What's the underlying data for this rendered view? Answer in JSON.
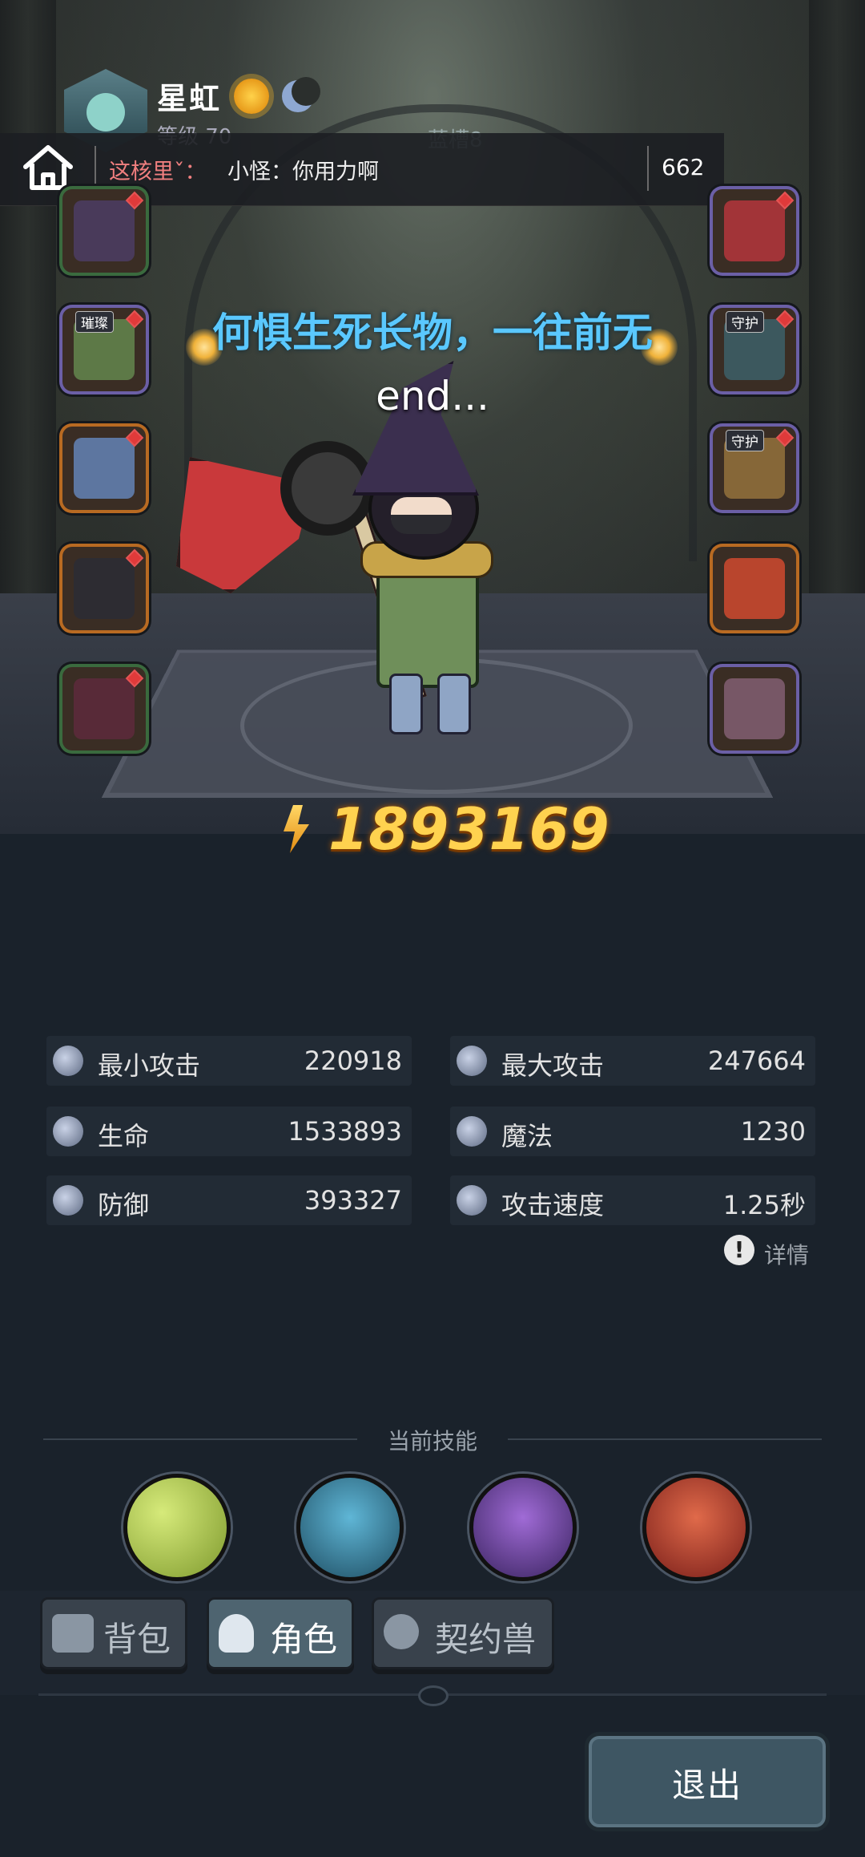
{
  "player": {
    "name": "星虹",
    "level_text": "等级 70",
    "mana_text": "蓝槽8"
  },
  "chat": {
    "sender": "这核里ˇ：",
    "message": "小怪：你用力啊",
    "count": "662"
  },
  "motto": "何惧生死长物，一往前无",
  "motto_sub": "end...",
  "power": "1893169",
  "equipment": {
    "left": [
      {
        "icon": "helmet-icon",
        "color": "#3a6a3e"
      },
      {
        "icon": "armor-icon",
        "tag": "璀璨",
        "color": "#6b5fa6"
      },
      {
        "icon": "boots-icon",
        "color": "#b86a22"
      },
      {
        "icon": "gloves-icon",
        "color": "#b86a22"
      },
      {
        "icon": "cloak-icon",
        "color": "#3a6a3e"
      }
    ],
    "right": [
      {
        "icon": "axe-weapon-icon",
        "color": "#6b5fa6"
      },
      {
        "icon": "ring-icon",
        "tag": "守护",
        "color": "#6b5fa6"
      },
      {
        "icon": "necklace-icon",
        "tag": "守护",
        "color": "#6b5fa6"
      },
      {
        "icon": "charm-icon",
        "color": "#b86a22"
      },
      {
        "icon": "pouch-icon",
        "color": "#6b5fa6"
      }
    ]
  },
  "stats": [
    {
      "label": "最小攻击",
      "value": "220918",
      "icon": "sword-icon"
    },
    {
      "label": "最大攻击",
      "value": "247664",
      "icon": "sword-icon"
    },
    {
      "label": "生命",
      "value": "1533893",
      "icon": "heart-icon"
    },
    {
      "label": "魔法",
      "value": "1230",
      "icon": "magic-icon"
    },
    {
      "label": "防御",
      "value": "393327",
      "icon": "shield-icon"
    },
    {
      "label": "攻击速度",
      "value": "1.25秒",
      "icon": "speed-icon"
    }
  ],
  "detail_label": "详情",
  "skills_title": "当前技能",
  "skills": [
    {
      "icon": "poison-bubbles-skill-icon",
      "color": "#9fb84a"
    },
    {
      "icon": "water-shield-skill-icon",
      "color": "#2f6e86"
    },
    {
      "icon": "purple-blade-skill-icon",
      "color": "#5b3f86"
    },
    {
      "icon": "crossed-axes-skill-icon",
      "color": "#b33b2b"
    }
  ],
  "tabs": [
    {
      "label": "背包",
      "icon": "bag-icon"
    },
    {
      "label": "角色",
      "icon": "character-icon",
      "active": true
    },
    {
      "label": "契约兽",
      "icon": "paw-icon"
    }
  ],
  "exit_label": "退出",
  "colors": {
    "motto": "#5ac8ff",
    "power": "#ffd24f",
    "chat_sender": "#f07f7f"
  }
}
